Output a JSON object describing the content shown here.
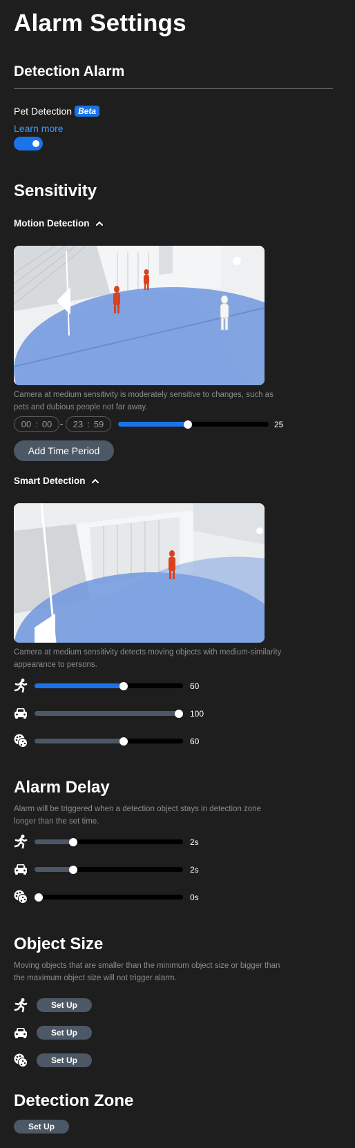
{
  "page": {
    "title": "Alarm Settings"
  },
  "detection_alarm": {
    "heading": "Detection Alarm",
    "pet_label": "Pet Detection",
    "beta_badge": "Beta",
    "learn_more": "Learn more",
    "toggle_on": true
  },
  "sensitivity": {
    "heading": "Sensitivity",
    "motion": {
      "title": "Motion Detection",
      "description": "Camera at medium sensitivity is moderately sensitive to changes, such as pets and dubious people not far away.",
      "start": {
        "hh": "00",
        "mm": "00"
      },
      "end": {
        "hh": "23",
        "mm": "59"
      },
      "time_separator": ":",
      "range_dash": "-",
      "value": 25,
      "value_label": "25",
      "fraction": 0.49,
      "add_time_period": "Add Time Period"
    },
    "smart": {
      "title": "Smart Detection",
      "description": "Camera at medium sensitivity detects moving objects with medium-similarity appearance to persons.",
      "rows": [
        {
          "icon": "person-running-icon",
          "value": "60",
          "fraction": 0.6,
          "active": true
        },
        {
          "icon": "vehicle-icon",
          "value": "100",
          "fraction": 1.0,
          "active": false
        },
        {
          "icon": "pet-icon",
          "value": "60",
          "fraction": 0.6,
          "active": false
        }
      ]
    }
  },
  "alarm_delay": {
    "heading": "Alarm Delay",
    "description": "Alarm will be triggered when a detection object stays in detection zone longer than the set time.",
    "rows": [
      {
        "icon": "person-running-icon",
        "value": "2s",
        "fraction": 0.26
      },
      {
        "icon": "vehicle-icon",
        "value": "2s",
        "fraction": 0.26
      },
      {
        "icon": "pet-icon",
        "value": "0s",
        "fraction": 0.0
      }
    ]
  },
  "object_size": {
    "heading": "Object Size",
    "description": "Moving objects that are smaller than the minimum object size or bigger than the maximum object size will not trigger alarm.",
    "setup_label": "Set Up",
    "rows": [
      {
        "icon": "person-running-icon"
      },
      {
        "icon": "vehicle-icon"
      },
      {
        "icon": "pet-icon"
      }
    ]
  },
  "detection_zone": {
    "heading": "Detection Zone",
    "setup_label": "Set Up"
  },
  "colors": {
    "background": "#1e1e1e",
    "accent": "#1a73e8",
    "muted_fill": "#4d5866",
    "zone_blue": "#5b87d6",
    "person_red": "#d9421c"
  }
}
